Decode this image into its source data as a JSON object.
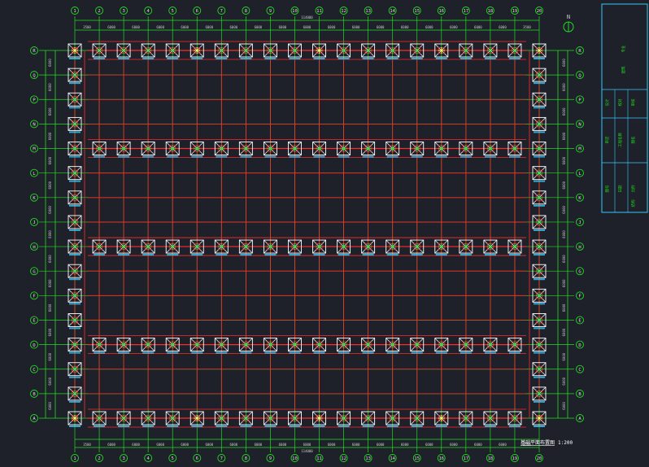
{
  "drawing": {
    "column_labels": [
      "1",
      "2",
      "3",
      "4",
      "5",
      "6",
      "7",
      "8",
      "9",
      "10",
      "11",
      "12",
      "13",
      "14",
      "15",
      "16",
      "17",
      "18",
      "19",
      "20"
    ],
    "row_labels": [
      "R",
      "Q",
      "P",
      "N",
      "M",
      "L",
      "K",
      "J",
      "H",
      "G",
      "F",
      "E",
      "D",
      "C",
      "B",
      "A"
    ],
    "span_dim_label": "6000",
    "end_span_dim_label": "3500",
    "total_length_label": "114000",
    "north_label": "N",
    "drawing_title": "基础平面布置图",
    "scale_label": "1:200",
    "pit_rows": [
      "R",
      "M",
      "H",
      "D",
      "A"
    ]
  },
  "title_block": {
    "cells": [
      "设计",
      "校对",
      "审核",
      "审定",
      "工程名称",
      "图名",
      "图号",
      "日期",
      "比例",
      "专业",
      "建筑",
      "结构"
    ]
  },
  "colors": {
    "background": "#1e2129",
    "grid_major": "#ff2a2a",
    "axis_green": "#22dd22",
    "footing_white": "#ffffff",
    "label_cyan": "#33ccff",
    "highlight_yellow": "#ffff33"
  }
}
